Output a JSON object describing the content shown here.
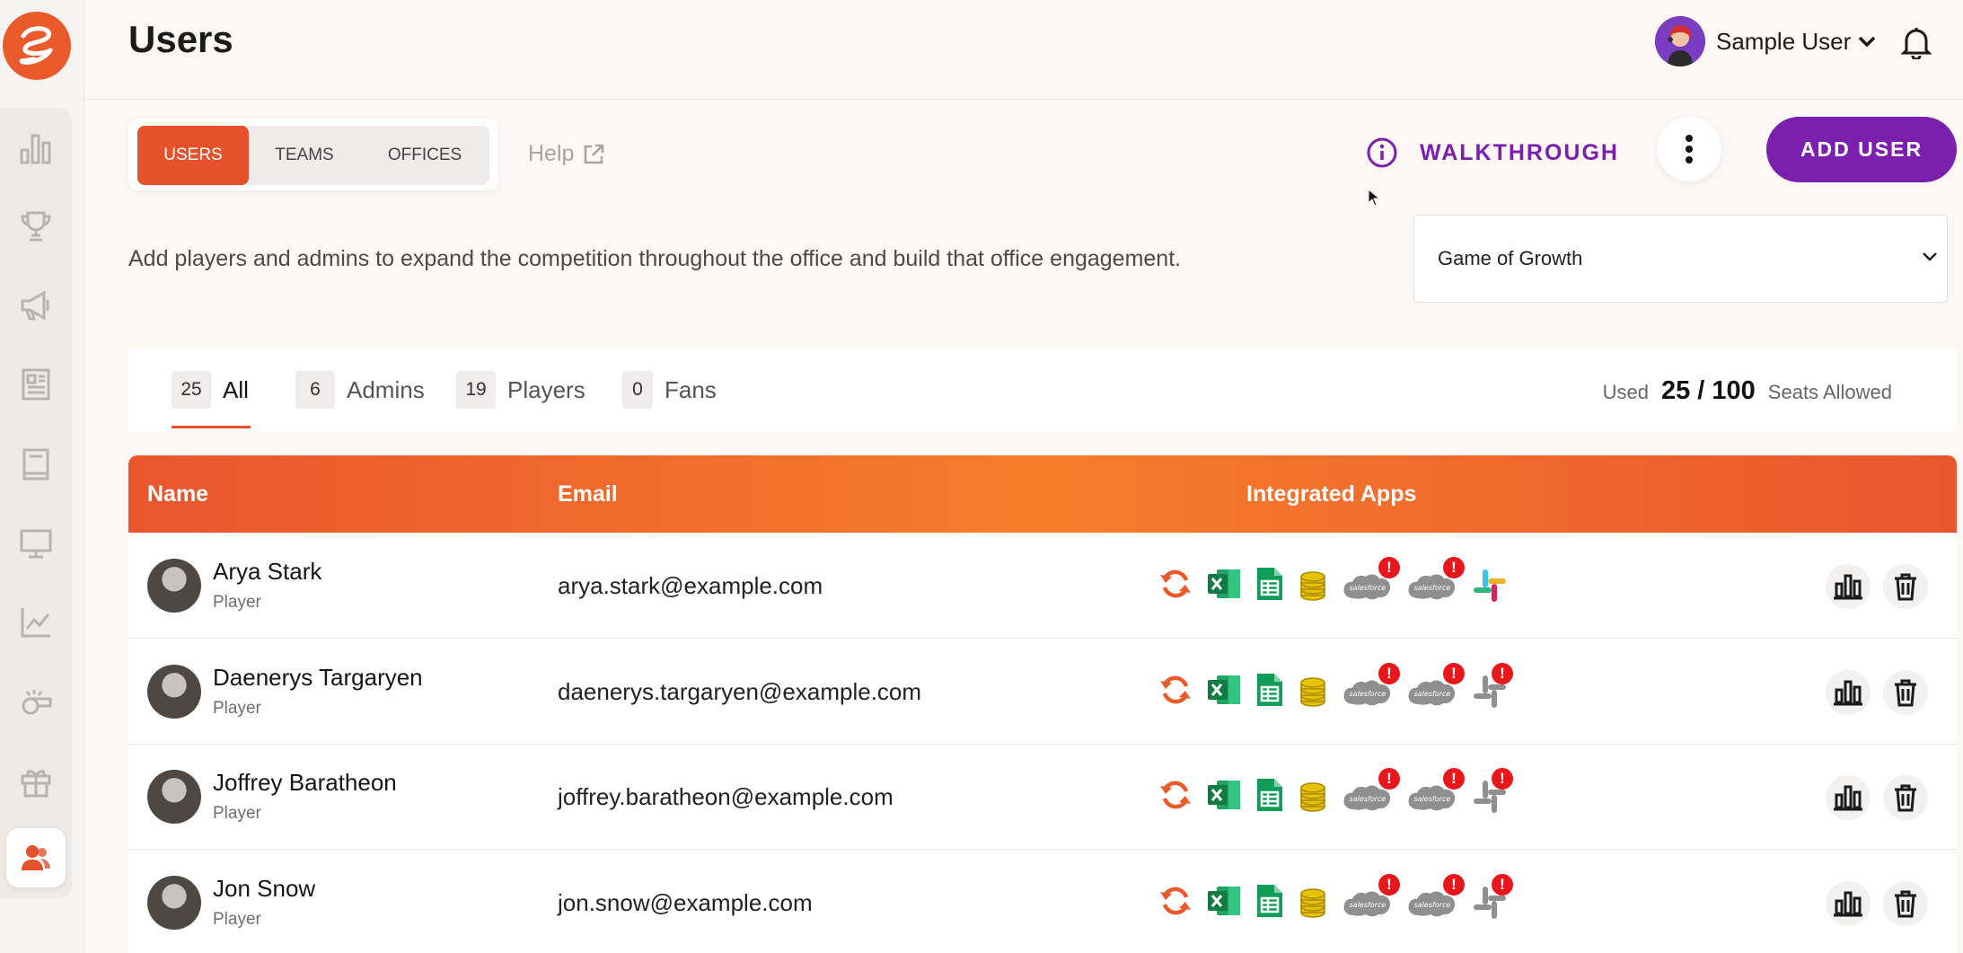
{
  "header": {
    "title": "Users",
    "user_name": "Sample User"
  },
  "tabs": [
    {
      "label": "USERS"
    },
    {
      "label": "TEAMS"
    },
    {
      "label": "OFFICES"
    }
  ],
  "help_label": "Help",
  "walkthrough_label": "WALKTHROUGH",
  "add_user_label": "ADD USER",
  "description": "Add players and admins to expand the competition throughout the office and build that office engagement.",
  "game_select": {
    "value": "Game of Growth"
  },
  "filters": [
    {
      "count": "25",
      "label": "All"
    },
    {
      "count": "6",
      "label": "Admins"
    },
    {
      "count": "19",
      "label": "Players"
    },
    {
      "count": "0",
      "label": "Fans"
    }
  ],
  "seats": {
    "used_label": "Used",
    "value": "25 / 100",
    "suffix": "Seats Allowed"
  },
  "table": {
    "columns": {
      "name": "Name",
      "email": "Email",
      "apps": "Integrated Apps"
    },
    "rows": [
      {
        "name": "Arya Stark",
        "role": "Player",
        "email": "arya.stark@example.com"
      },
      {
        "name": "Daenerys Targaryen",
        "role": "Player",
        "email": "daenerys.targaryen@example.com"
      },
      {
        "name": "Joffrey Baratheon",
        "role": "Player",
        "email": "joffrey.baratheon@example.com"
      },
      {
        "name": "Jon Snow",
        "role": "Player",
        "email": "jon.snow@example.com"
      }
    ],
    "salesforce_label": "salesforce"
  },
  "colors": {
    "accent": "#e5512a",
    "purple": "#7b1fae",
    "alert": "#e8171c"
  },
  "icons": [
    "logo-icon",
    "chart-icon",
    "trophy-icon",
    "megaphone-icon",
    "newspaper-icon",
    "book-icon",
    "monitor-icon",
    "line-chart-icon",
    "whistle-icon",
    "gift-icon",
    "users-icon",
    "chevron-down-icon",
    "bell-icon",
    "external-link-icon",
    "info-icon",
    "kebab-icon",
    "sync-icon",
    "excel-icon",
    "sheets-icon",
    "coins-icon",
    "salesforce-icon",
    "slack-icon",
    "stats-icon",
    "trash-icon"
  ]
}
